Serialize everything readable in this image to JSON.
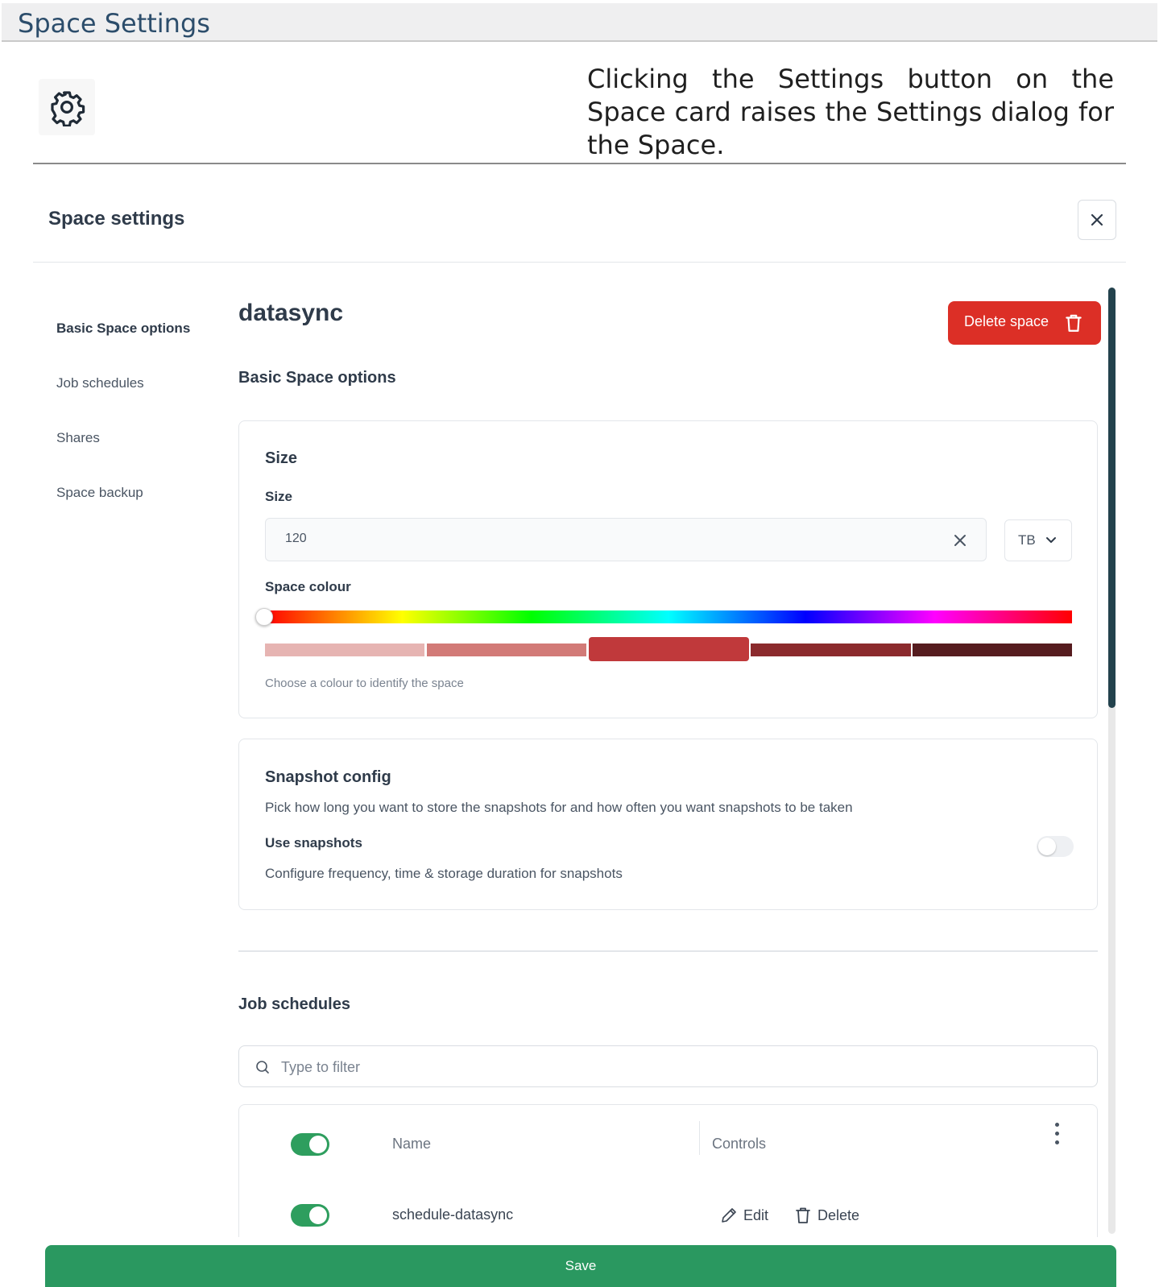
{
  "doc": {
    "title": "Space Settings",
    "intro": "Clicking the Settings button on the Space card raises the Settings dialog for the Space."
  },
  "dialog": {
    "title": "Space settings",
    "close_icon": "close-icon"
  },
  "sidebar": {
    "items": [
      {
        "label": "Basic Space options",
        "active": true
      },
      {
        "label": "Job schedules",
        "active": false
      },
      {
        "label": "Shares",
        "active": false
      },
      {
        "label": "Space backup",
        "active": false
      }
    ]
  },
  "space": {
    "name": "datasync",
    "delete_label": "Delete space",
    "section_title": "Basic Space options"
  },
  "size_card": {
    "heading": "Size",
    "field_label": "Size",
    "value": "120",
    "unit": "TB",
    "colour_label": "Space colour",
    "hint": "Choose a colour to identify the space",
    "hue_value": 0,
    "swatches": [
      "#e6b4b2",
      "#d27a77",
      "#c0393b",
      "#8b2a2d",
      "#561c1f"
    ],
    "selected_swatch": 2
  },
  "snapshot_card": {
    "heading": "Snapshot config",
    "description": "Pick how long you want to store the snapshots for and how often you want snapshots to be taken",
    "use_label": "Use snapshots",
    "use_description": "Configure frequency, time & storage duration for snapshots",
    "enabled": false
  },
  "jobs": {
    "title": "Job schedules",
    "filter_placeholder": "Type to filter",
    "columns": [
      "Name",
      "Controls"
    ],
    "rows": [
      {
        "name": "schedule-datasync",
        "enabled": true,
        "edit_label": "Edit",
        "delete_label": "Delete"
      }
    ]
  },
  "footer": {
    "save_label": "Save"
  },
  "colors": {
    "accent_green": "#2a9860",
    "danger_red": "#dc2f26",
    "scroll_thumb": "#23424d"
  }
}
